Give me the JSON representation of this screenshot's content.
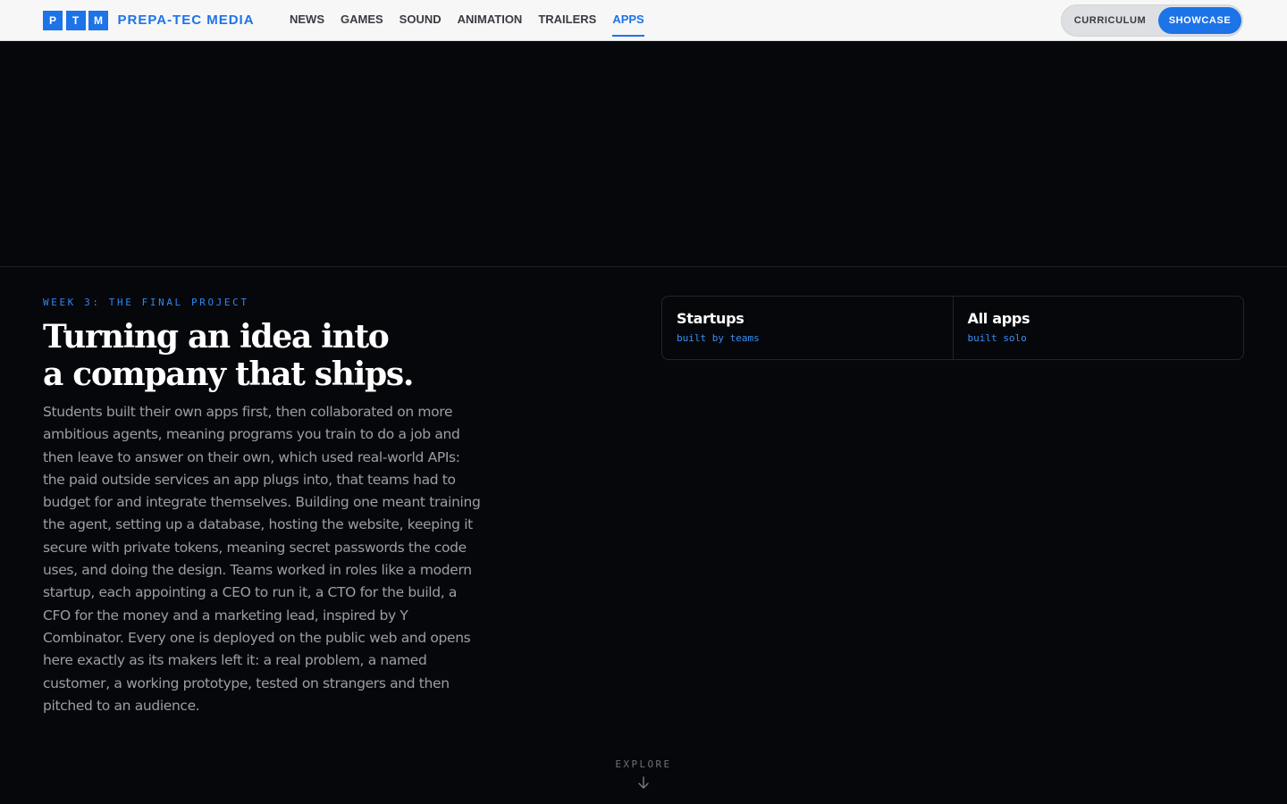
{
  "brand": {
    "logo_letters": [
      "P",
      "T",
      "M"
    ],
    "name": "PREPA-TEC MEDIA",
    "accent_color": "#1d73e8"
  },
  "nav": {
    "items": [
      {
        "label": "NEWS"
      },
      {
        "label": "GAMES"
      },
      {
        "label": "SOUND"
      },
      {
        "label": "ANIMATION"
      },
      {
        "label": "TRAILERS"
      },
      {
        "label": "APPS",
        "active": true
      }
    ]
  },
  "mode_toggle": {
    "options": [
      "CURRICULUM",
      "SHOWCASE"
    ],
    "selected": "SHOWCASE"
  },
  "section": {
    "kicker": "WEEK 3: THE FINAL PROJECT",
    "headline_line1": "Turning an idea into",
    "headline_line2": "a company that ships.",
    "body": "Students built their own apps first, then collaborated on more ambitious agents, meaning programs you train to do a job and then leave to answer on their own, which used real-world APIs: the paid outside services an app plugs into, that teams had to budget for and integrate themselves. Building one meant training the agent, setting up a database, hosting the website, keeping it secure with private tokens, meaning secret passwords the code uses, and doing the design. Teams worked in roles like a modern startup, each appointing a CEO to run it, a CTO for the build, a CFO for the money and a marketing lead, inspired by Y Combinator. Every one is deployed on the public web and opens here exactly as its makers left it: a real problem, a named customer, a working prototype, tested on strangers and then pitched to an audience."
  },
  "cards": [
    {
      "title": "Startups",
      "subtitle": "built by teams"
    },
    {
      "title": "All apps",
      "subtitle": "built solo"
    }
  ],
  "explore": {
    "label": "EXPLORE",
    "icon": "arrow-down-icon"
  }
}
